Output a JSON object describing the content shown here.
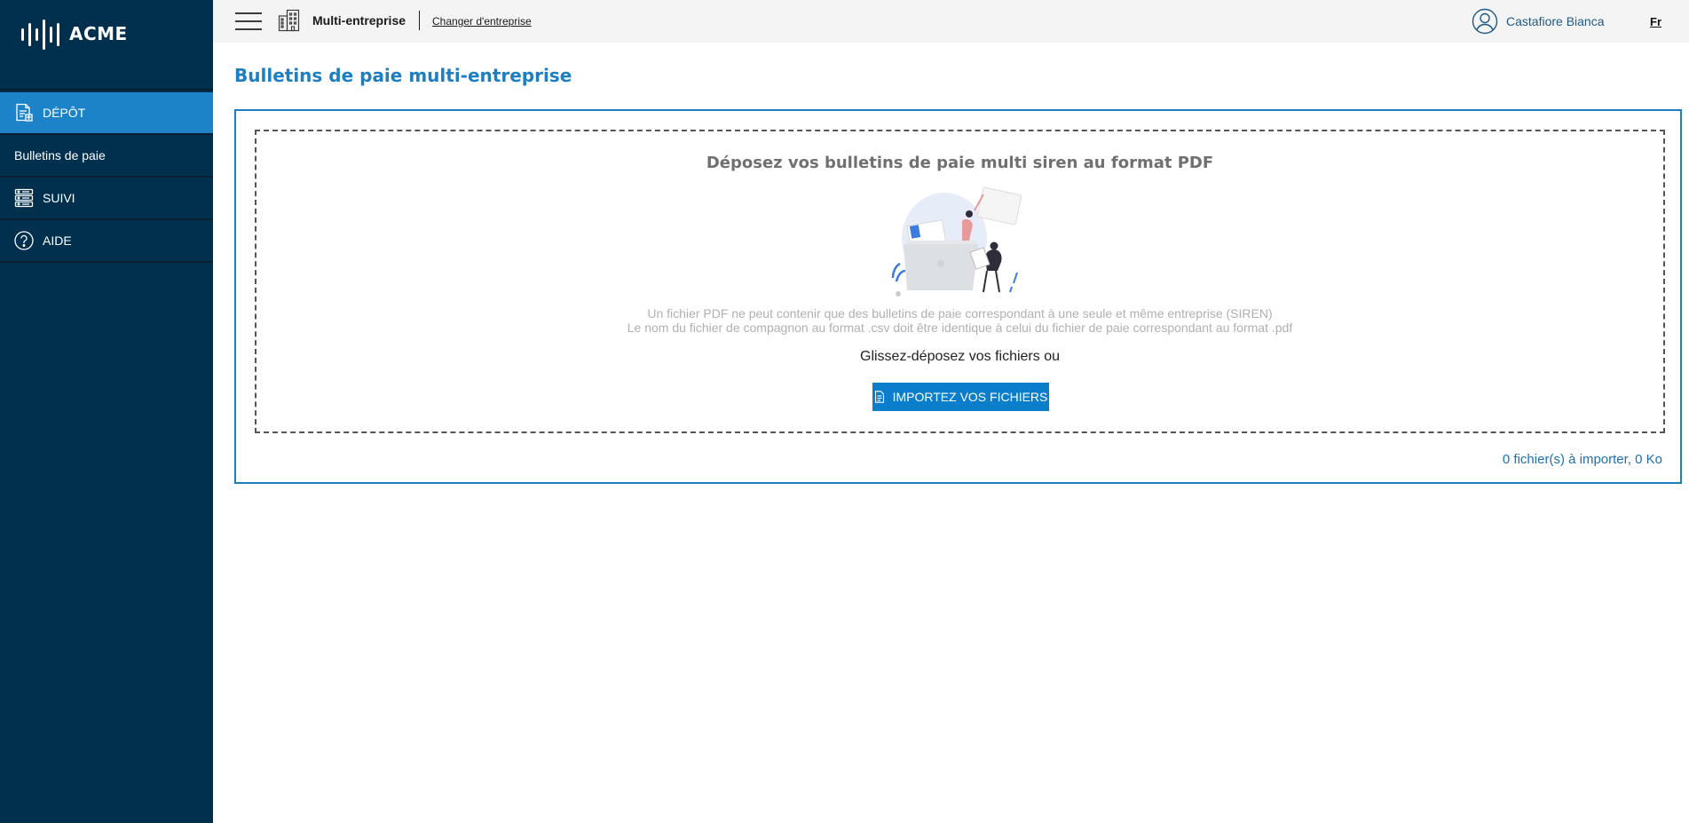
{
  "brand": {
    "name": "ACME"
  },
  "sidebar": {
    "items": [
      {
        "label": "DÉPÔT",
        "icon": "document-upload-icon",
        "active": true
      },
      {
        "label": "Bulletins de paie",
        "icon": "",
        "active": false
      },
      {
        "label": "SUIVI",
        "icon": "server-list-icon",
        "active": false
      },
      {
        "label": "AIDE",
        "icon": "help-circle-icon",
        "active": false
      }
    ]
  },
  "topbar": {
    "company": "Multi-entreprise",
    "change_company": "Changer d'entreprise",
    "user_name": "Castafiore Bianca",
    "language": "Fr"
  },
  "main": {
    "title": "Bulletins de paie multi-entreprise",
    "dropzone": {
      "heading": "Déposez vos bulletins de paie multi siren au format PDF",
      "info_line_1": "Un fichier PDF ne peut contenir que des bulletins de paie correspondant à une seule et même entreprise (SIREN)",
      "info_line_2": "Le nom du fichier de compagnon au format .csv doit être identique à celui du fichier de paie correspondant au format .pdf",
      "drag_text": "Glissez-déposez vos fichiers ou",
      "import_button": "IMPORTEZ VOS FICHIERS"
    },
    "summary": "0 fichier(s) à importer, 0 Ko"
  },
  "colors": {
    "sidebar_bg": "#01304f",
    "active_item": "#1d83c9",
    "accent": "#1d7fc2",
    "button": "#0a7dcb"
  }
}
